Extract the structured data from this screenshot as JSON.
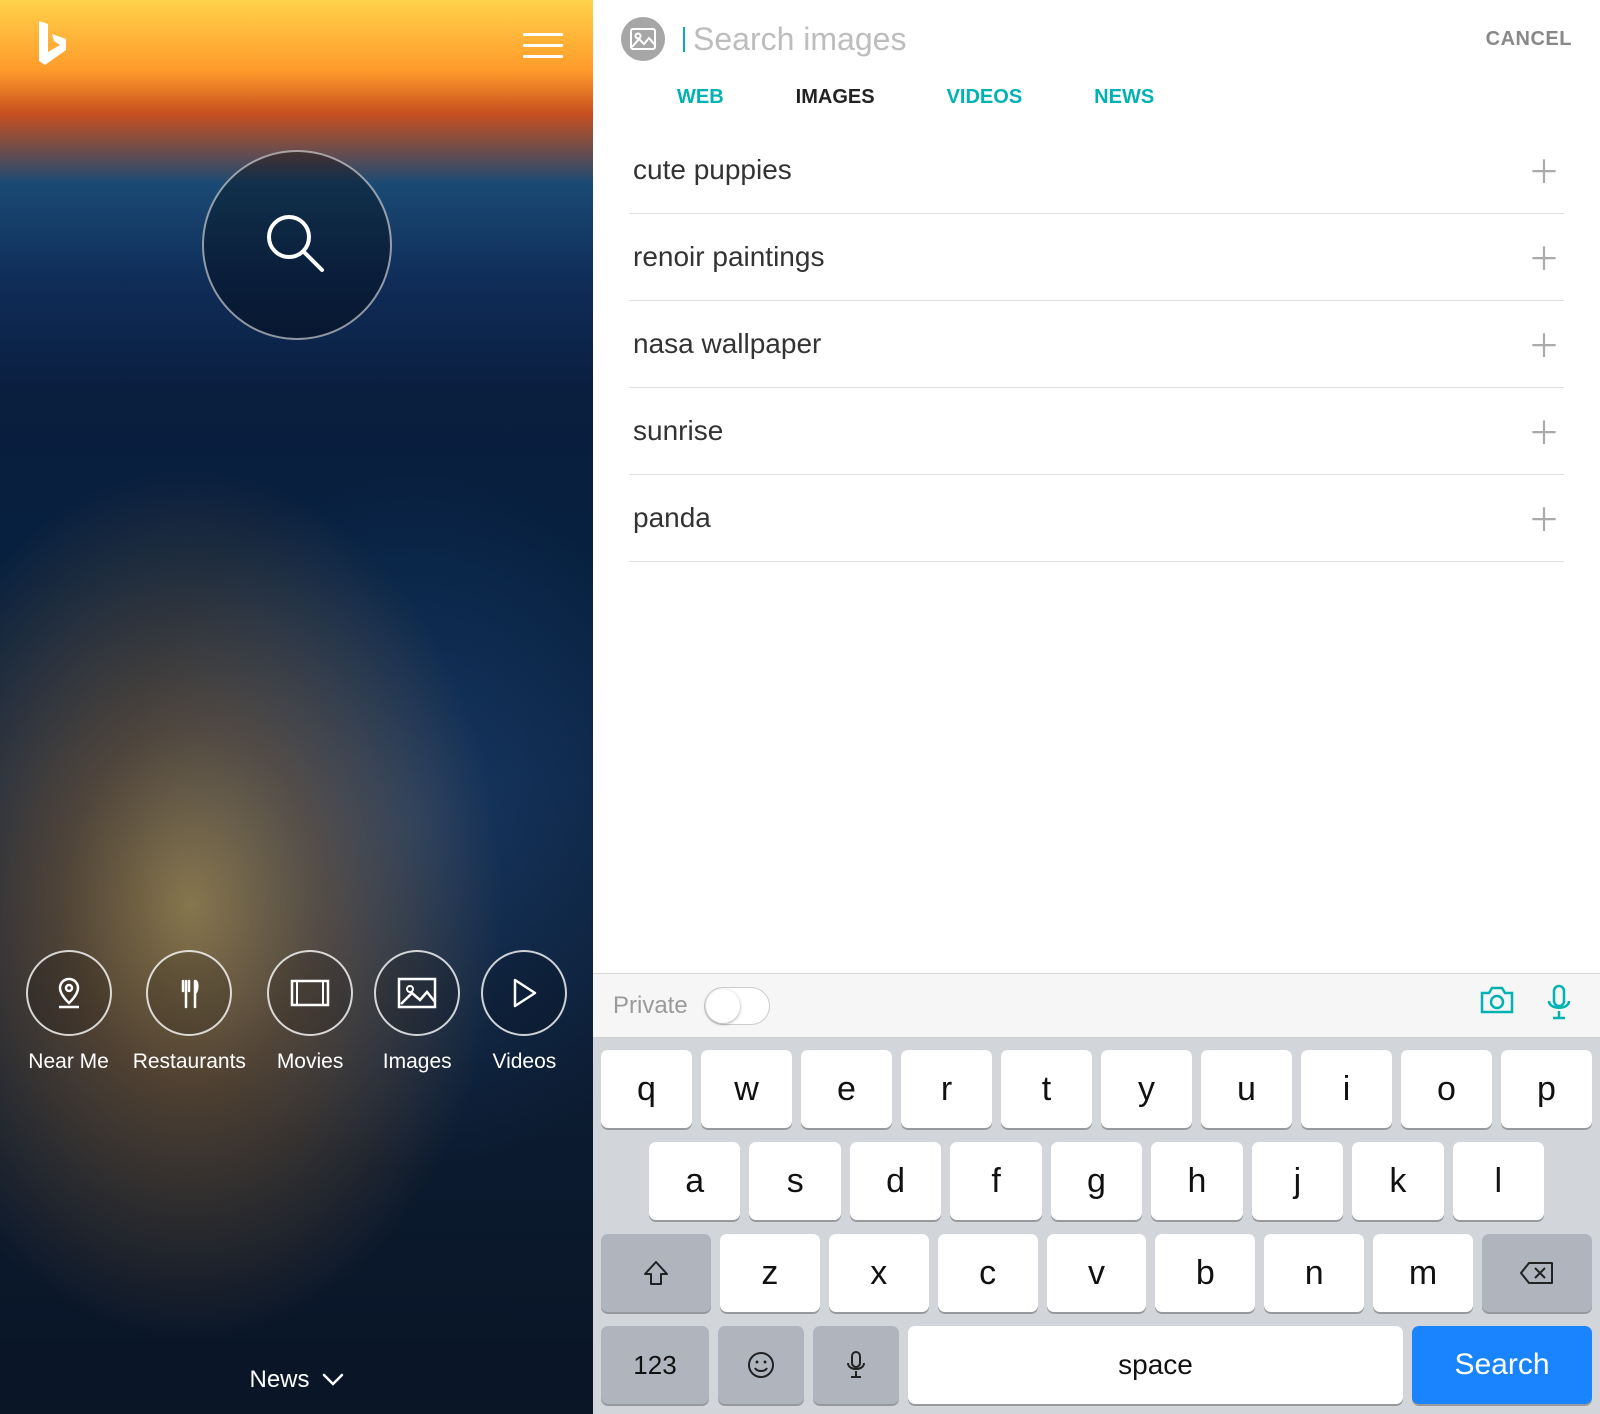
{
  "left": {
    "categories": [
      {
        "label": "Near Me"
      },
      {
        "label": "Restaurants"
      },
      {
        "label": "Movies"
      },
      {
        "label": "Images"
      },
      {
        "label": "Videos"
      }
    ],
    "news_label": "News"
  },
  "right": {
    "search_placeholder": "Search images",
    "cancel": "CANCEL",
    "tabs": {
      "web": "WEB",
      "images": "IMAGES",
      "videos": "VIDEOS",
      "news": "NEWS"
    },
    "suggestions": [
      "cute puppies",
      "renoir paintings",
      "nasa wallpaper",
      "sunrise",
      "panda"
    ],
    "private_label": "Private"
  },
  "keyboard": {
    "row1": [
      "q",
      "w",
      "e",
      "r",
      "t",
      "y",
      "u",
      "i",
      "o",
      "p"
    ],
    "row2": [
      "a",
      "s",
      "d",
      "f",
      "g",
      "h",
      "j",
      "k",
      "l"
    ],
    "row3": [
      "z",
      "x",
      "c",
      "v",
      "b",
      "n",
      "m"
    ],
    "k123": "123",
    "space": "space",
    "search": "Search"
  }
}
